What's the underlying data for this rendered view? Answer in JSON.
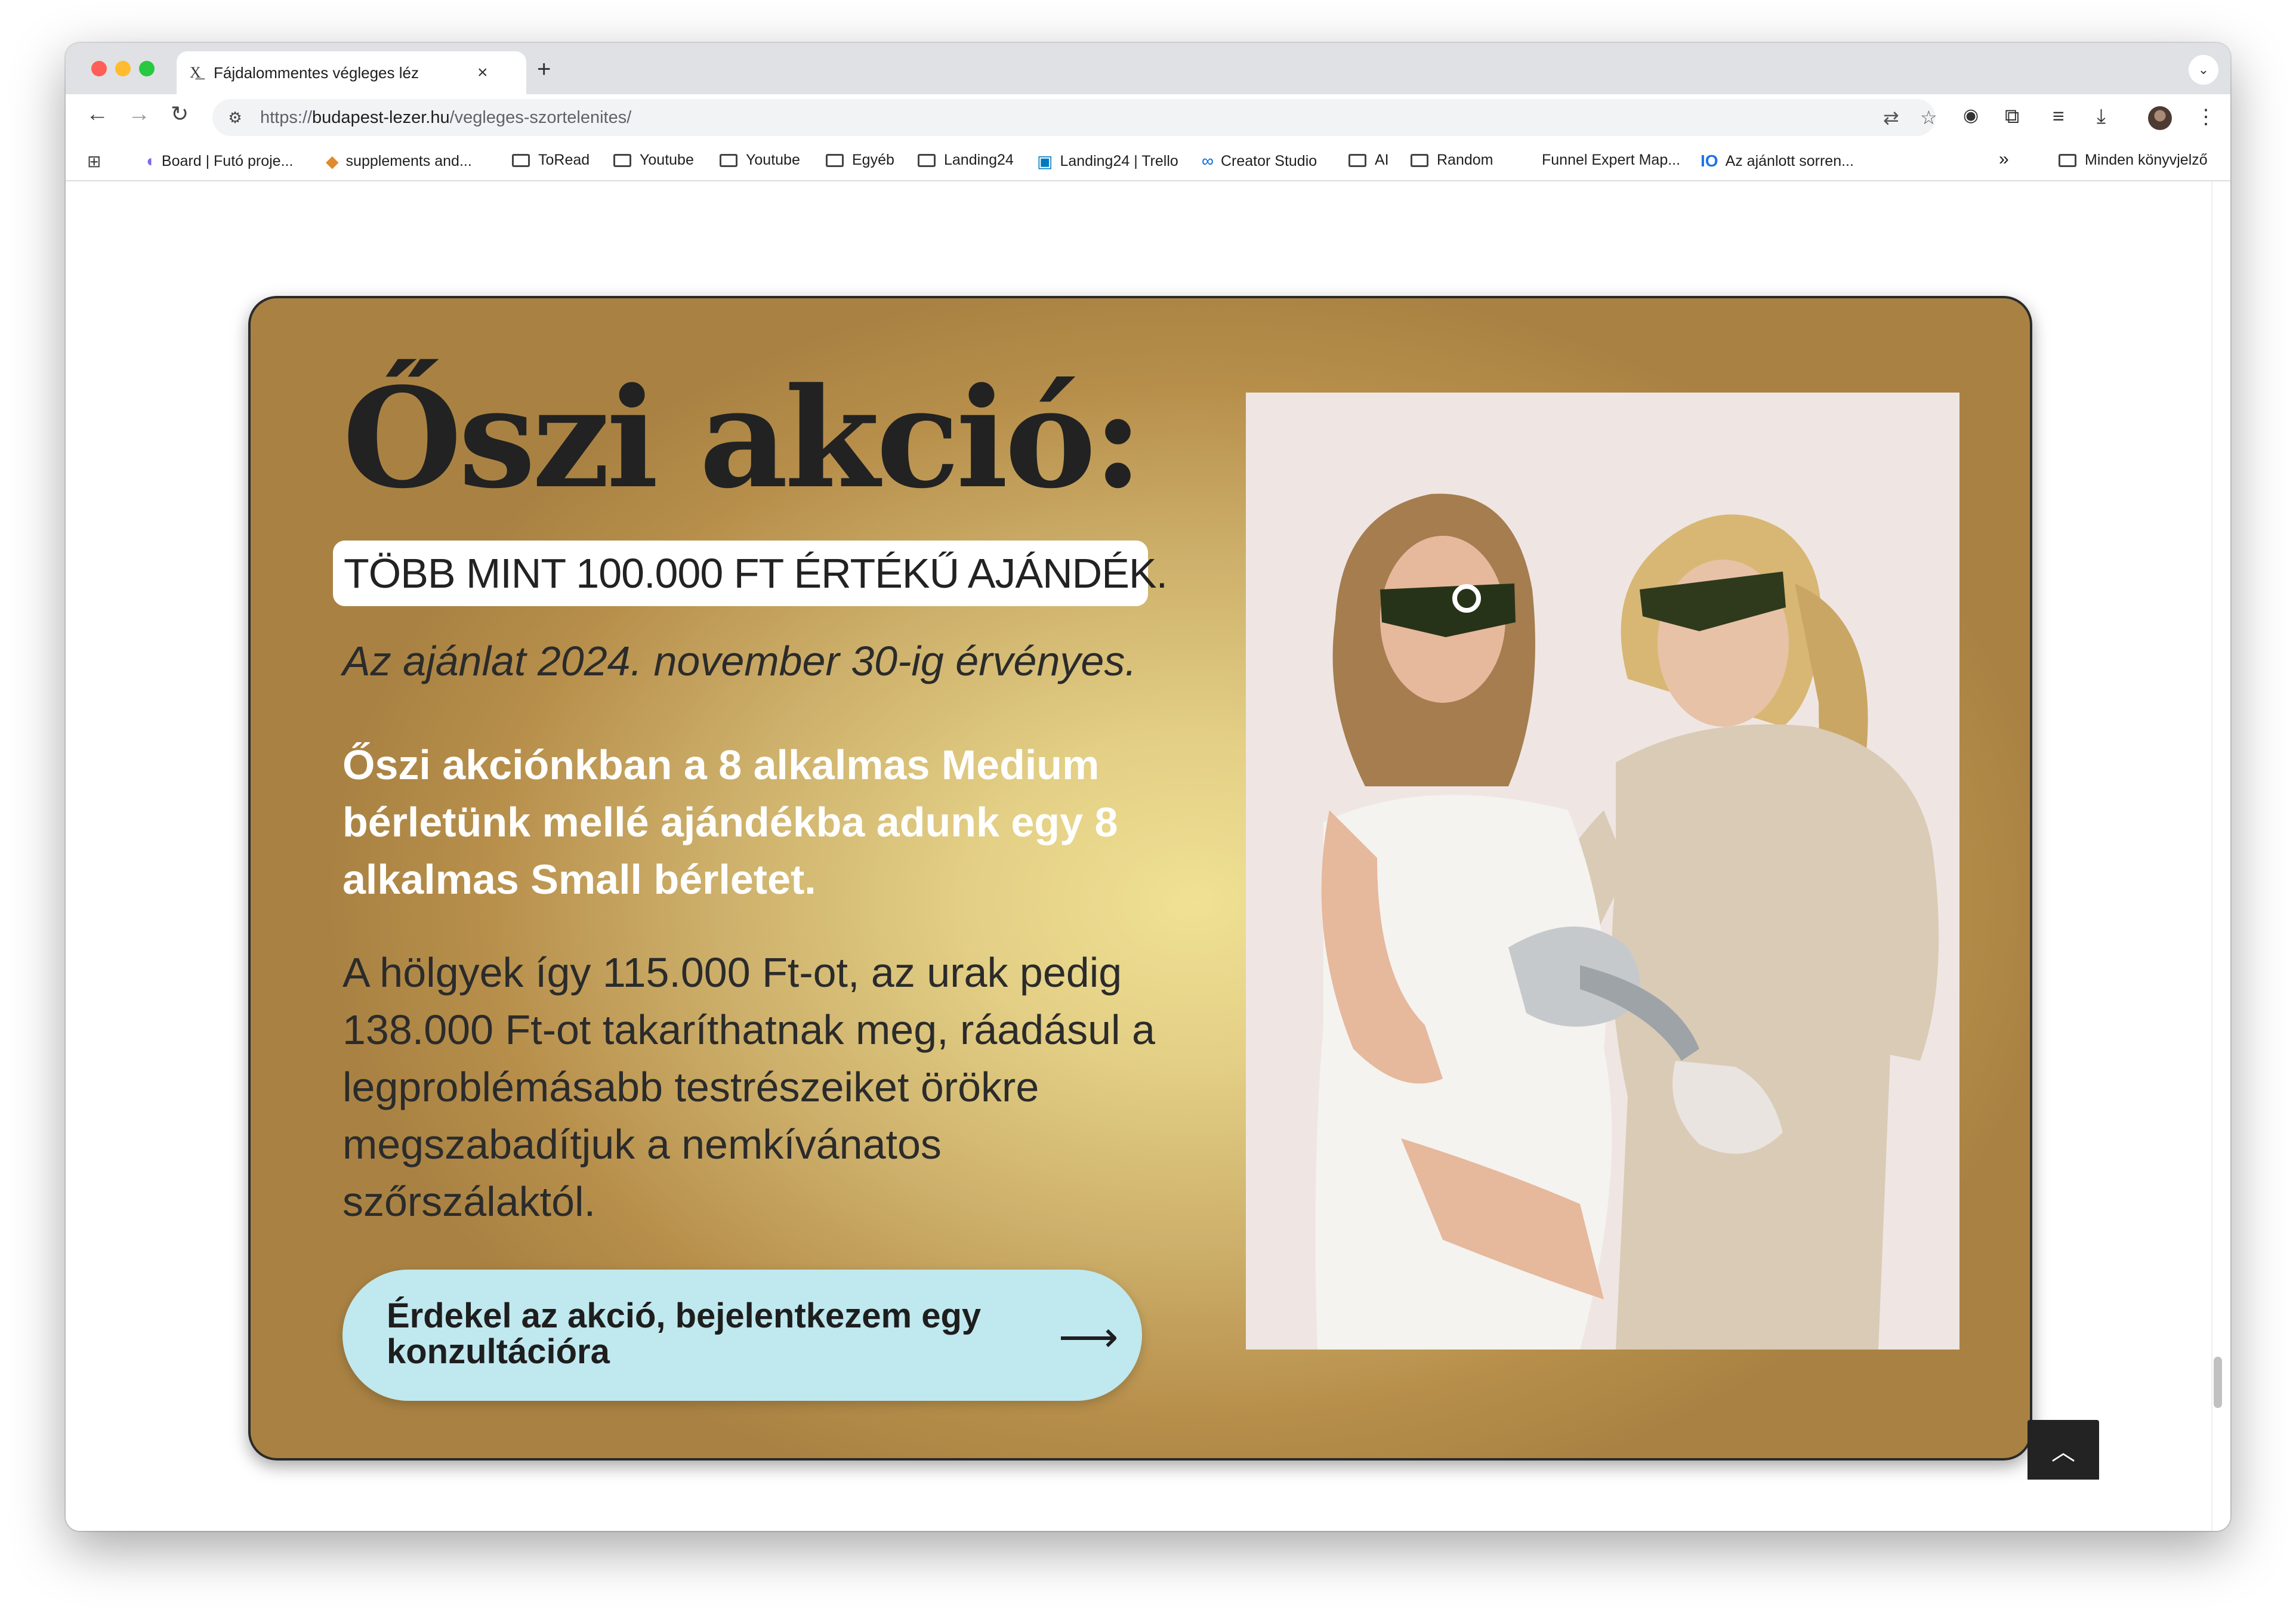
{
  "browser": {
    "tab_title": "Fájdalommentes végleges léz",
    "tab_favicon": "X͟",
    "new_tab": "+",
    "close": "×",
    "url_prefix": "https://",
    "url_host": "budapest-lezer.hu",
    "url_path": "/vegleges-szortelenites/",
    "icons": [
      "back-icon",
      "forward-icon",
      "reload-icon",
      "site-info-icon",
      "translate-icon",
      "star-icon",
      "camera-icon",
      "extensions-icon",
      "reading-list-icon",
      "download-icon",
      "avatar",
      "menu-icon"
    ]
  },
  "bookmarks": [
    {
      "label": "Board | Futó proje...",
      "icon": "clickup-icon"
    },
    {
      "label": "supplements and...",
      "icon": "pill-icon"
    },
    {
      "label": "ToRead",
      "icon": "folder-icon"
    },
    {
      "label": "Youtube",
      "icon": "folder-icon"
    },
    {
      "label": "Youtube",
      "icon": "folder-icon"
    },
    {
      "label": "Egyéb",
      "icon": "folder-icon"
    },
    {
      "label": "Landing24",
      "icon": "folder-icon"
    },
    {
      "label": "Landing24 | Trello",
      "icon": "trello-icon"
    },
    {
      "label": "Creator Studio",
      "icon": "meta-icon"
    },
    {
      "label": "AI",
      "icon": "folder-icon"
    },
    {
      "label": "Random",
      "icon": "folder-icon"
    },
    {
      "label": "Funnel Expert Map...",
      "icon": ""
    },
    {
      "label": "Az ajánlott sorren...",
      "icon": "io-icon"
    }
  ],
  "bookmarks_overflow": "»",
  "all_bookmarks": "Minden könyvjelző",
  "promo": {
    "headline": "Őszi akció:",
    "gift": "TÖBB MINT 100.000 FT ÉRTÉKŰ AJÁNDÉK.",
    "validity": "Az ajánlat 2024. november 30-ig érvényes.",
    "offer": "Őszi akciónkban a 8 alkalmas Medium bérletünk mellé ajándékba adunk egy 8 alkalmas Small bérletet.",
    "savings": "A hölgyek így 115.000 Ft-ot, az urak pedig 138.000 Ft-ot takaríthatnak meg, ráadásul a legproblémásabb testrészeiket örökre megszabadítjuk a nemkívánatos szőrszálaktól.",
    "cta_label": "Érdekel az akció, bejelentkezem egy konzultációra",
    "cta_arrow": "⟶"
  },
  "back_to_top": "︿",
  "colors": {
    "card_gold": "#cdb06b",
    "cta_bg": "#c0e8ef",
    "headline": "#222222"
  }
}
